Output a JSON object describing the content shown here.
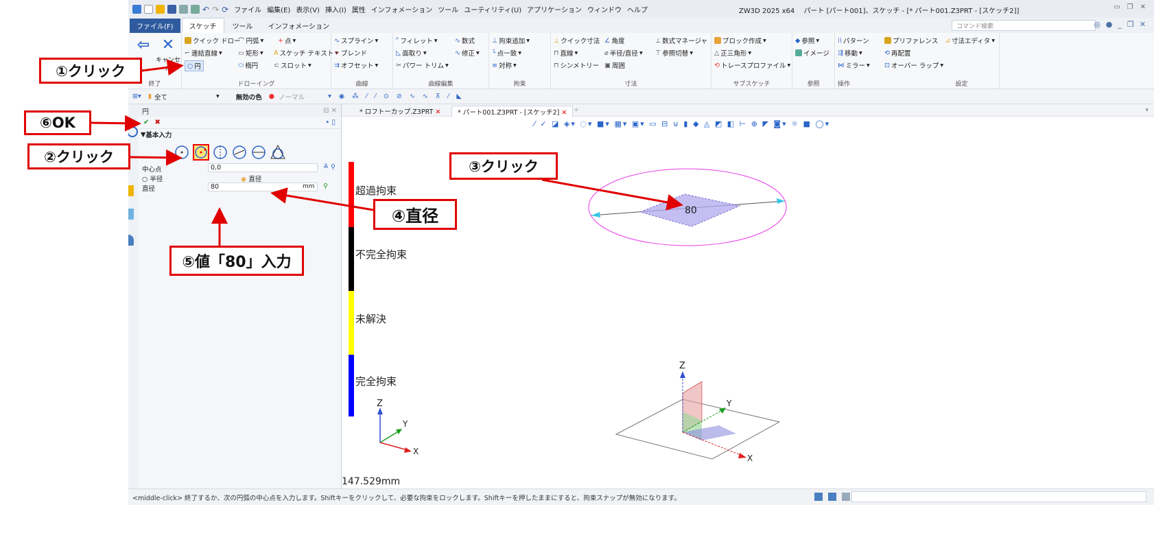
{
  "titlebar": {
    "menu": [
      "ファイル",
      "編集(E)",
      "表示(V)",
      "挿入(I)",
      "属性",
      "インフォメーション",
      "ツール",
      "ユーティリティ(U)",
      "アプリケーション",
      "ウィンドウ",
      "ヘルプ"
    ],
    "app_title": "ZW3D 2025 x64",
    "doc_title": "パート [パート001]、スケッチ - [* パート001.Z3PRT - [スケッチ2]]"
  },
  "tabs": {
    "file": "ファイル(F)",
    "sketch": "スケッチ",
    "tool": "ツール",
    "info": "インフォメーション",
    "search_placeholder": "コマンド検索"
  },
  "ribbon": {
    "end": {
      "exit": "終了",
      "cancel": "キャンセル",
      "label": "終了"
    },
    "drawing": {
      "items": [
        "クイック ドロー",
        "円弧",
        "点",
        "連結直線",
        "矩形",
        "スケッチ テキスト",
        "円",
        "楕円",
        "スロット"
      ],
      "label": "ドローイング"
    },
    "curve": {
      "items": [
        "スプライン",
        "ブレンド",
        "オフセット"
      ],
      "label": "曲線"
    },
    "curve_edit": {
      "items": [
        "フィレット",
        "面取り",
        "パワー トリム",
        "数式",
        "修正"
      ],
      "label": "曲線編集"
    },
    "constraint": {
      "items": [
        "拘束追加",
        "点一致",
        "対称"
      ],
      "label": "拘束"
    },
    "dimension": {
      "items": [
        "クイック寸法",
        "直線",
        "シンメトリー",
        "角度",
        "半径/直径",
        "周囲",
        "数式マネージャ",
        "参照切替"
      ],
      "label": "寸法"
    },
    "subsketch": {
      "items": [
        "ブロック作成",
        "正三角形",
        "トレースプロファイル"
      ],
      "label": "サブスケッチ"
    },
    "reference": {
      "items": [
        "参照",
        "イメージ"
      ],
      "label": "参照"
    },
    "operation": {
      "items": [
        "パターン",
        "移動",
        "ミラー",
        "プリファレンス",
        "再配置",
        "オーバー ラップ",
        "寸法エディタ"
      ],
      "label": "操作"
    },
    "settings_label": "設定"
  },
  "toolrow": {
    "filter": "全て",
    "invalid_color": "無効の色",
    "normal": "ノーマル"
  },
  "panel": {
    "title": "円",
    "section": "基本入力",
    "center_label": "中心点",
    "center_value": "0,0",
    "radius_option": "半径",
    "diameter_option": "直径",
    "diameter_label": "直径",
    "diameter_value": "80",
    "unit": "mm"
  },
  "doc_tabs": [
    "* ロフトーカップ.Z3PRT",
    "* パート001.Z3PRT - [スケッチ2]"
  ],
  "legend": [
    "超過拘束",
    "不完全拘束",
    "未解決",
    "完全拘束"
  ],
  "legend_colors": [
    "#ff0000",
    "#000000",
    "#ffff00",
    "#0000ff"
  ],
  "dimension_value": "80",
  "scale_readout": "147.529mm",
  "status_text": "<middle-click> 終了するか、次の円弧の中心点を入力します。Shiftキーをクリックして、必要な拘束をロックします。Shiftキーを押したままにすると、拘束スナップが無効になります。",
  "annotations": {
    "a1": "①クリック",
    "a2": "②クリック",
    "a3": "③クリック",
    "a4": "④直径",
    "a5": "⑤値「80」入力",
    "a6": "⑥OK"
  }
}
